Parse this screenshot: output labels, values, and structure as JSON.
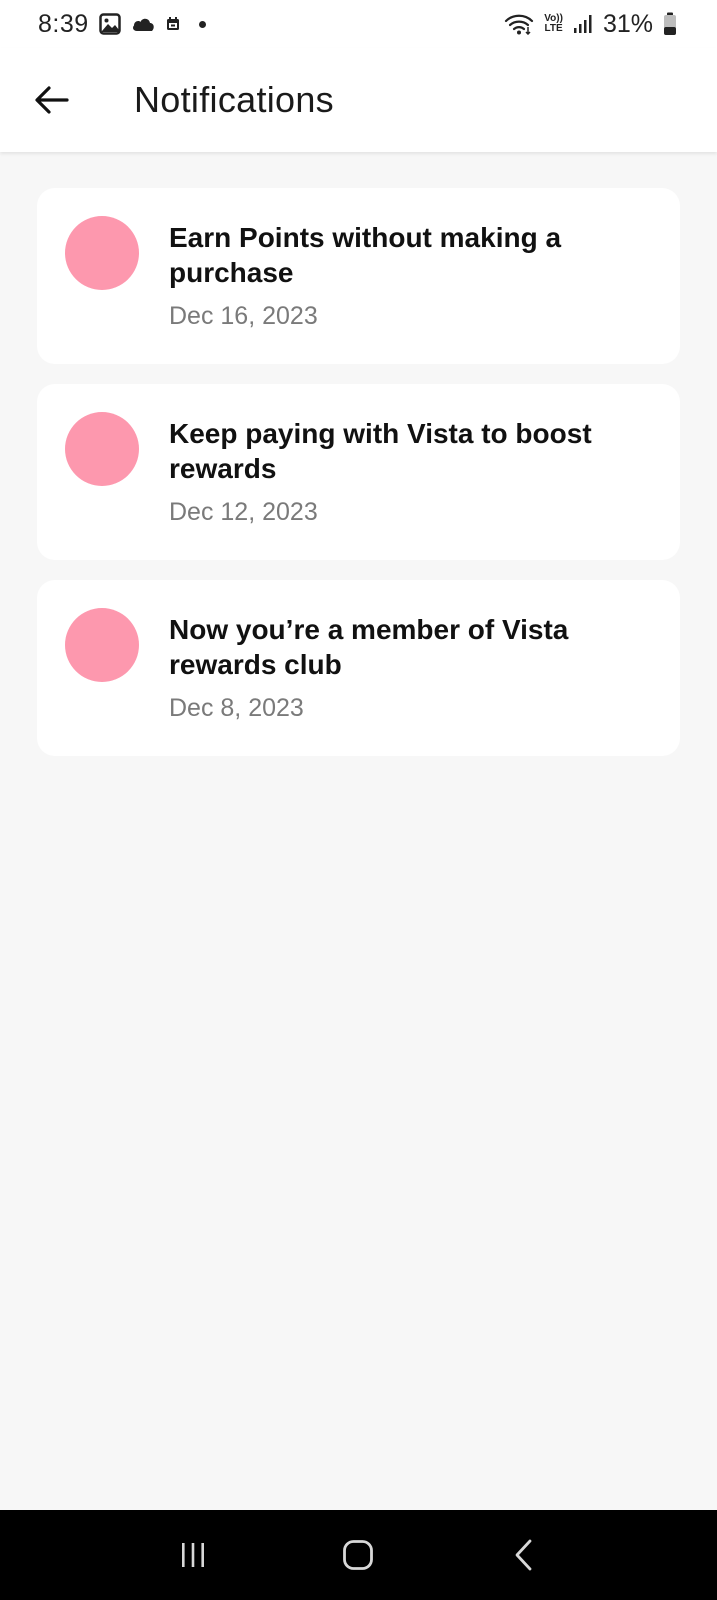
{
  "status_bar": {
    "time": "8:39",
    "battery_percent": "31%",
    "network_label_top": "Vo))",
    "network_label_bottom": "LTE",
    "icons": [
      "gallery-icon",
      "cloud-icon",
      "calendar-icon",
      "dot-icon",
      "wifi-icon",
      "signal-icon",
      "battery-icon"
    ]
  },
  "app_bar": {
    "title": "Notifications",
    "back_icon": "arrow-left-icon"
  },
  "notifications": [
    {
      "title": "Earn Points without making a purchase",
      "date": "Dec 16, 2023",
      "avatar_color": "#fd98ae"
    },
    {
      "title": "Keep paying with Vista to boost rewards",
      "date": "Dec 12, 2023",
      "avatar_color": "#fd98ae"
    },
    {
      "title": "Now you’re a member of Vista rewards club",
      "date": "Dec 8, 2023",
      "avatar_color": "#fd98ae"
    }
  ],
  "nav_bar": {
    "buttons": [
      "recents-icon",
      "home-icon",
      "back-icon"
    ]
  },
  "colors": {
    "background": "#f7f7f7",
    "card": "#ffffff",
    "avatar": "#fd98ae",
    "date_text": "#7a7a7a"
  }
}
